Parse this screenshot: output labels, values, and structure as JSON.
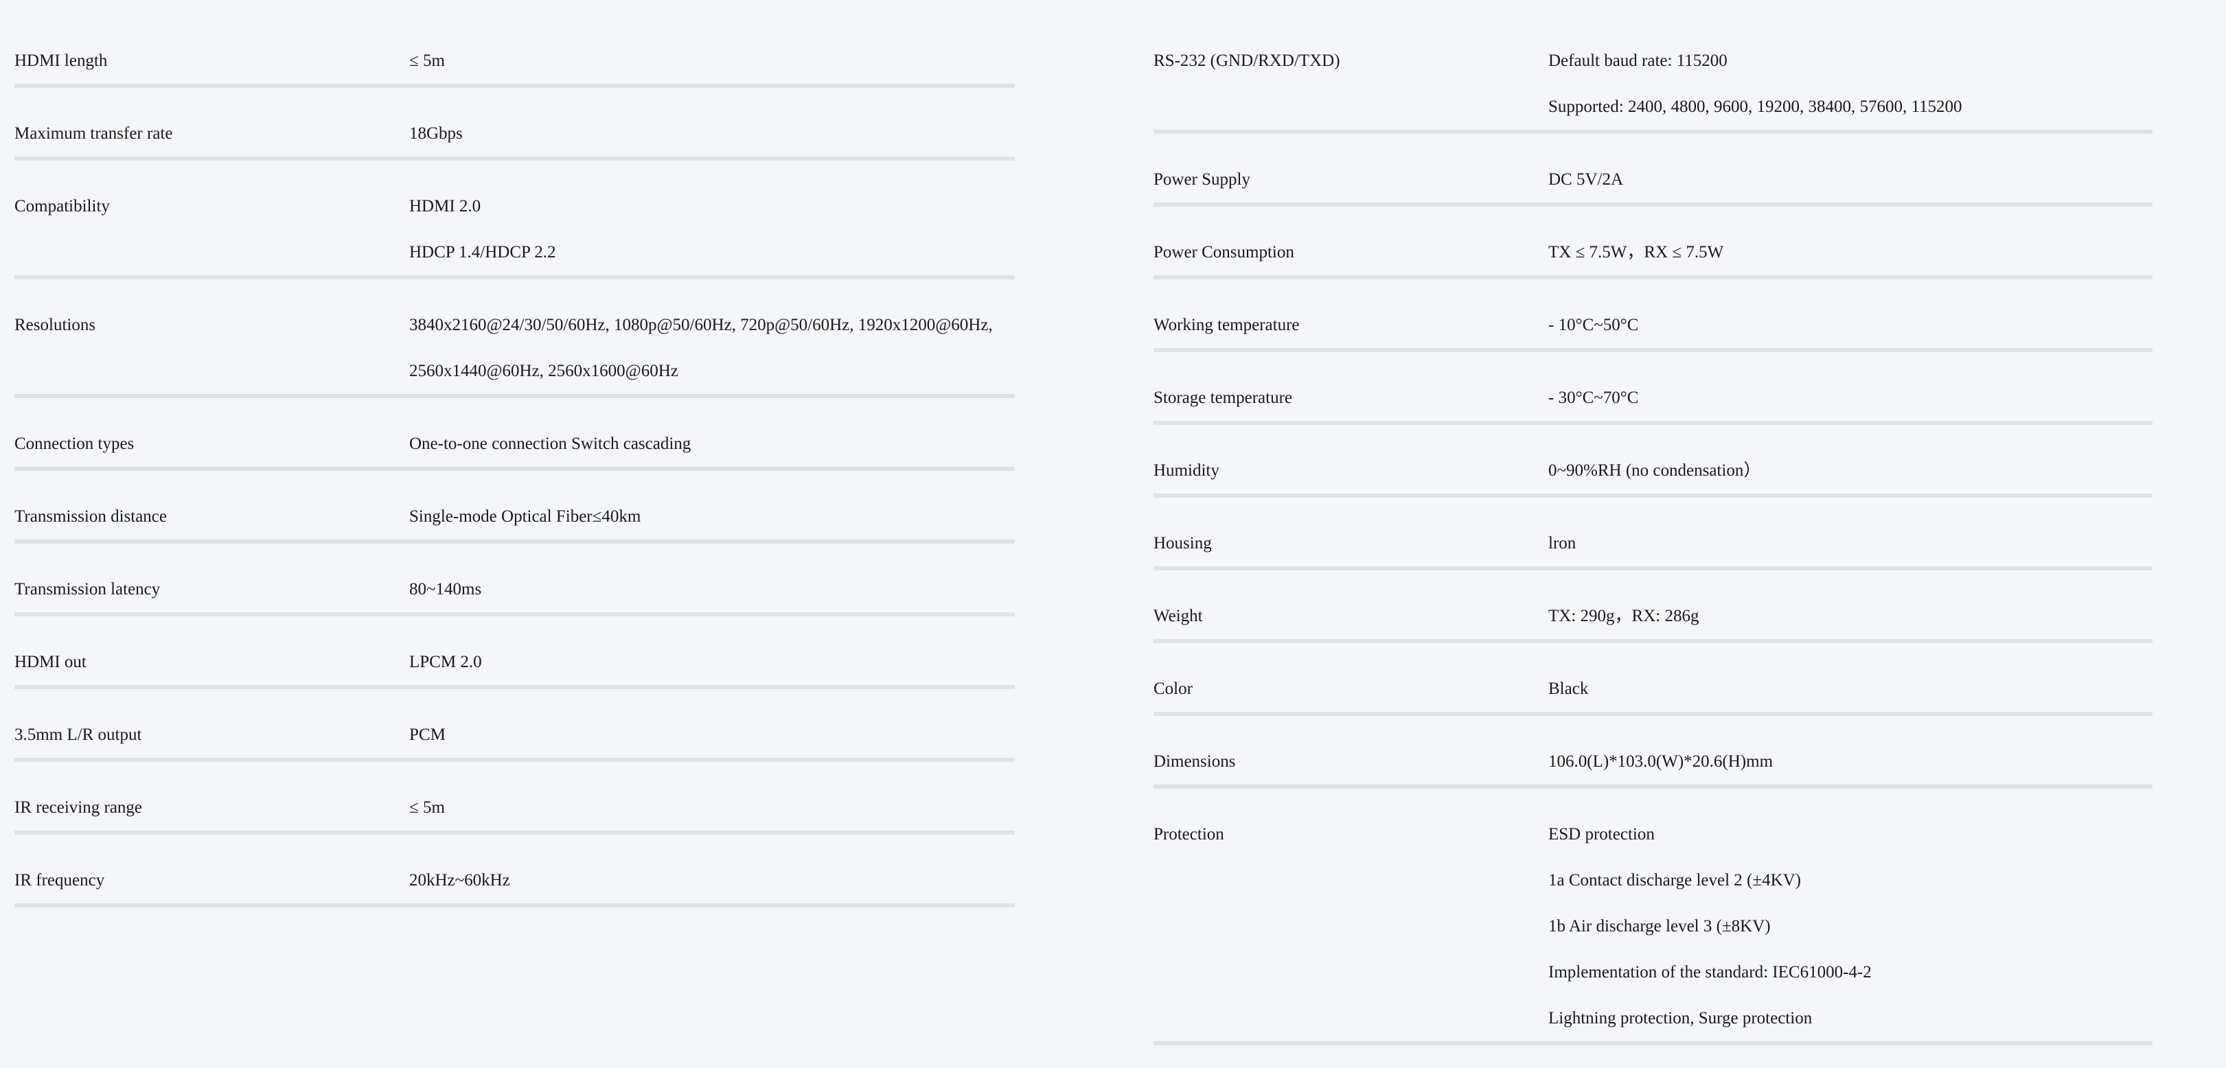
{
  "left_specs": [
    {
      "label": "HDMI length",
      "values": [
        "≤ 5m"
      ]
    },
    {
      "label": "Maximum transfer rate",
      "values": [
        "18Gbps"
      ]
    },
    {
      "label": "Compatibility",
      "values": [
        "HDMI 2.0",
        "HDCP 1.4/HDCP 2.2"
      ]
    },
    {
      "label": "Resolutions",
      "values": [
        "3840x2160@24/30/50/60Hz, 1080p@50/60Hz, 720p@50/60Hz, 1920x1200@60Hz,",
        "2560x1440@60Hz, 2560x1600@60Hz"
      ]
    },
    {
      "label": "Connection types",
      "values": [
        "One-to-one connection Switch cascading"
      ]
    },
    {
      "label": "Transmission distance",
      "values": [
        "Single-mode Optical Fiber≤40km"
      ]
    },
    {
      "label": "Transmission latency",
      "values": [
        "80~140ms"
      ]
    },
    {
      "label": "HDMI out",
      "values": [
        "LPCM 2.0"
      ]
    },
    {
      "label": "3.5mm L/R output",
      "values": [
        "PCM"
      ]
    },
    {
      "label": "IR receiving range",
      "values": [
        "≤ 5m"
      ]
    },
    {
      "label": "IR frequency",
      "values": [
        "20kHz~60kHz"
      ]
    }
  ],
  "right_specs": [
    {
      "label": "RS-232 (GND/RXD/TXD)",
      "values": [
        "Default baud rate: 115200",
        "Supported: 2400, 4800, 9600, 19200, 38400, 57600, 115200"
      ]
    },
    {
      "label": "Power Supply",
      "values": [
        "DC 5V/2A"
      ]
    },
    {
      "label": "Power Consumption",
      "values": [
        "TX ≤ 7.5W，RX ≤ 7.5W"
      ]
    },
    {
      "label": "Working temperature",
      "values": [
        "- 10°C~50°C"
      ]
    },
    {
      "label": "Storage temperature",
      "values": [
        "- 30°C~70°C"
      ]
    },
    {
      "label": "Humidity",
      "values": [
        "0~90%RH (no condensation）"
      ]
    },
    {
      "label": "Housing",
      "values": [
        "lron"
      ]
    },
    {
      "label": "Weight",
      "values": [
        "TX: 290g，RX: 286g"
      ]
    },
    {
      "label": "Color",
      "values": [
        "Black"
      ]
    },
    {
      "label": "Dimensions",
      "values": [
        "106.0(L)*103.0(W)*20.6(H)mm"
      ]
    },
    {
      "label": "Protection",
      "values": [
        "ESD protection",
        "1a Contact discharge level 2 (±4KV)",
        "1b Air discharge level 3 (±8KV)",
        "Implementation of the standard: IEC61000-4-2",
        "Lightning protection, Surge protection"
      ]
    }
  ]
}
